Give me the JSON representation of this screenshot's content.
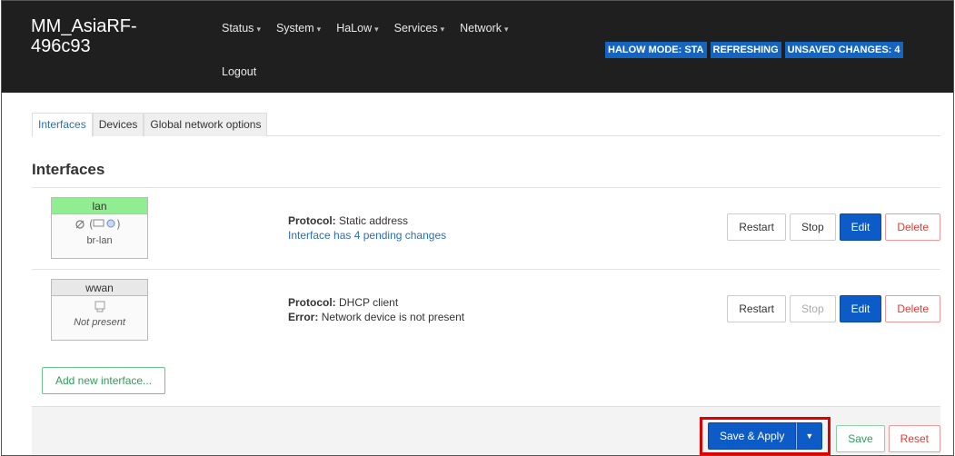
{
  "header": {
    "brand": "MM_AsiaRF-496c93",
    "menu": [
      "Status",
      "System",
      "HaLow",
      "Services",
      "Network"
    ],
    "logout": "Logout",
    "badges": [
      "HALOW MODE: STA",
      "REFRESHING",
      "UNSAVED CHANGES: 4"
    ]
  },
  "tabs": [
    "Interfaces",
    "Devices",
    "Global network options"
  ],
  "section_title": "Interfaces",
  "interfaces": [
    {
      "name": "lan",
      "device": "br-lan",
      "protocol_label": "Protocol:",
      "protocol": "Static address",
      "note": "Interface has 4 pending changes",
      "buttons": [
        "Restart",
        "Stop",
        "Edit",
        "Delete"
      ]
    },
    {
      "name": "wwan",
      "device": "Not present",
      "protocol_label": "Protocol:",
      "protocol": "DHCP client",
      "error_label": "Error:",
      "error": "Network device is not present",
      "buttons": [
        "Restart",
        "Stop",
        "Edit",
        "Delete"
      ]
    }
  ],
  "add_interface": "Add new interface...",
  "footer": {
    "save_apply": "Save & Apply",
    "save": "Save",
    "reset": "Reset"
  },
  "colors": {
    "header_bg": "#1f1f1f",
    "badge_bg": "#1565c0",
    "primary": "#0d5bc6",
    "lan_status": "#90ee90",
    "highlight": "#e00000"
  }
}
